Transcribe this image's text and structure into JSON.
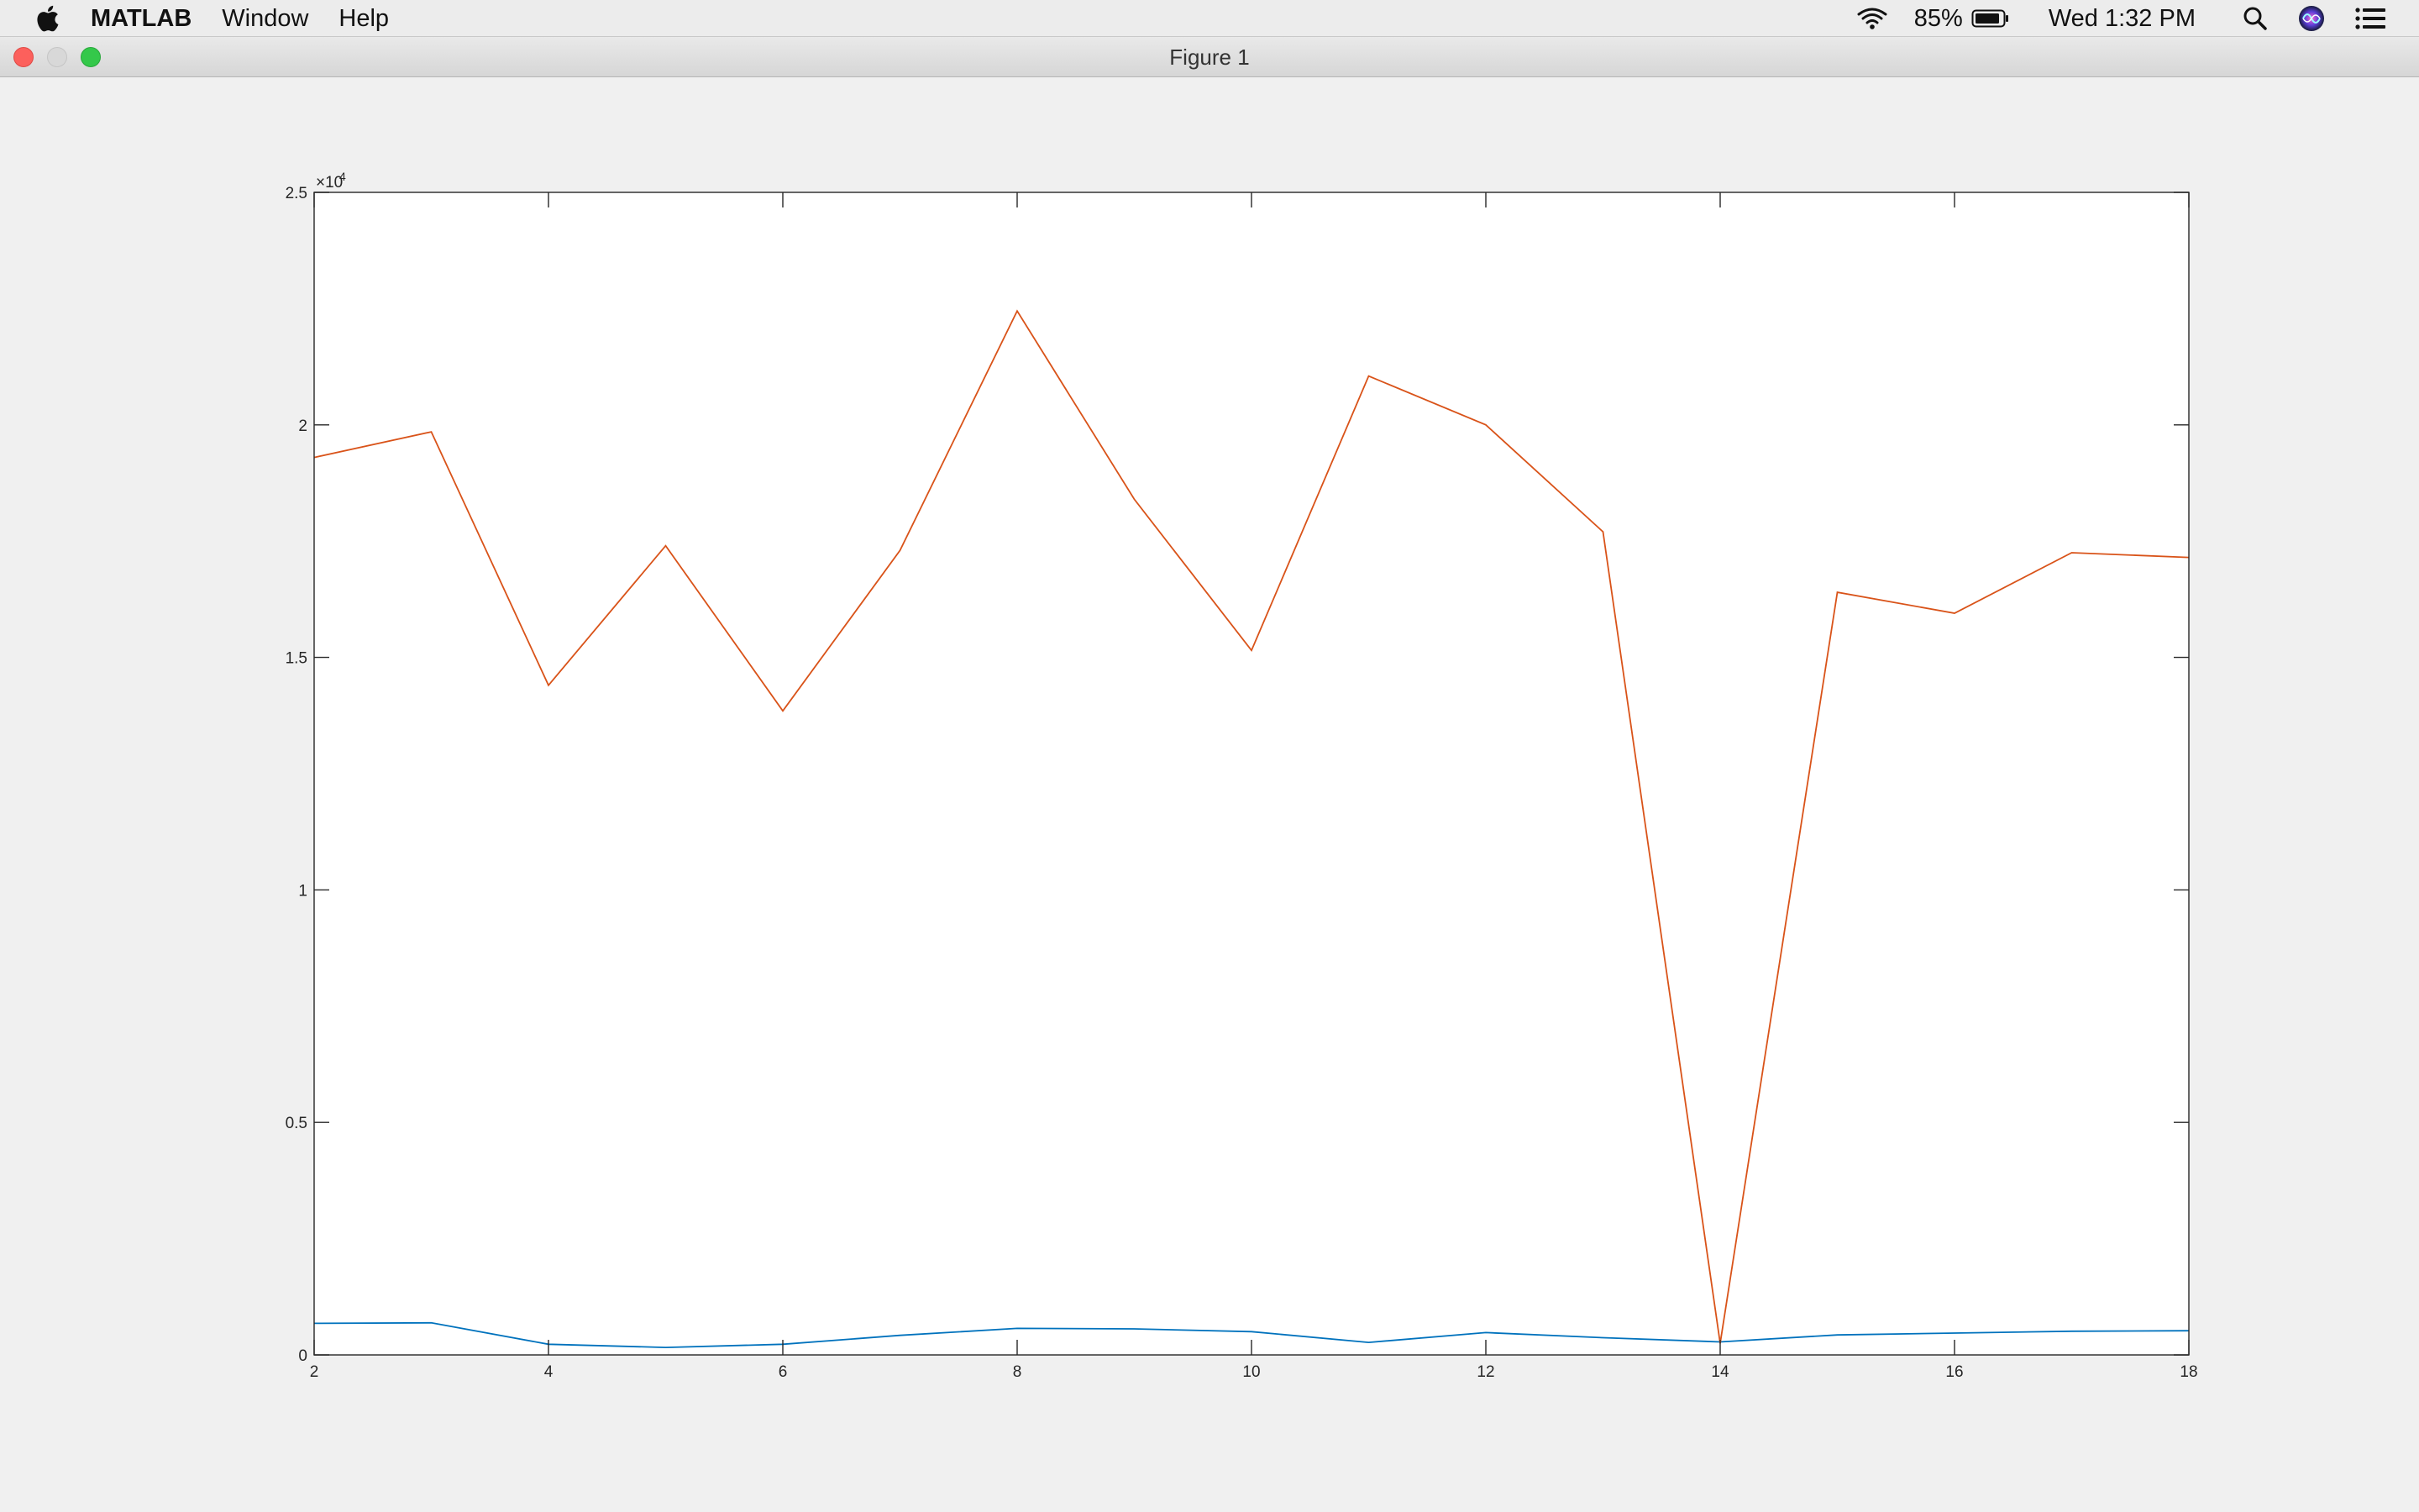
{
  "menubar": {
    "app_name": "MATLAB",
    "items": [
      {
        "label": "Window"
      },
      {
        "label": "Help"
      }
    ],
    "status": {
      "battery_percent": "85%",
      "clock": "Wed 1:32 PM"
    },
    "icons": [
      "apple-icon",
      "wifi-icon",
      "battery-icon",
      "search-icon",
      "siri-icon",
      "notification-center-icon"
    ]
  },
  "window": {
    "title": "Figure 1"
  },
  "chart_data": {
    "type": "line",
    "title": "",
    "xlabel": "",
    "ylabel": "",
    "xlim": [
      2,
      18
    ],
    "ylim": [
      0,
      25000
    ],
    "y_exponent_label": "×10",
    "y_exponent_power": "4",
    "x_ticks": [
      2,
      4,
      6,
      8,
      10,
      12,
      14,
      16,
      18
    ],
    "x_tick_labels": [
      "2",
      "4",
      "6",
      "8",
      "10",
      "12",
      "14",
      "16",
      "18"
    ],
    "y_ticks": [
      0,
      5000,
      10000,
      15000,
      20000,
      25000
    ],
    "y_tick_labels": [
      "0",
      "0.5",
      "1",
      "1.5",
      "2",
      "2.5"
    ],
    "grid": false,
    "x": [
      2,
      3,
      4,
      5,
      6,
      7,
      8,
      9,
      10,
      11,
      12,
      13,
      14,
      15,
      16,
      17,
      18
    ],
    "series": [
      {
        "color": "#0072bd",
        "values": [
          680,
          690,
          230,
          160,
          230,
          420,
          570,
          560,
          500,
          270,
          480,
          370,
          280,
          430,
          470,
          510,
          520
        ]
      },
      {
        "color": "#d95319",
        "values": [
          19300,
          19850,
          14400,
          17400,
          13850,
          17300,
          22450,
          18400,
          15150,
          21050,
          20000,
          17700,
          250,
          16400,
          15950,
          17250,
          17150
        ]
      }
    ]
  }
}
